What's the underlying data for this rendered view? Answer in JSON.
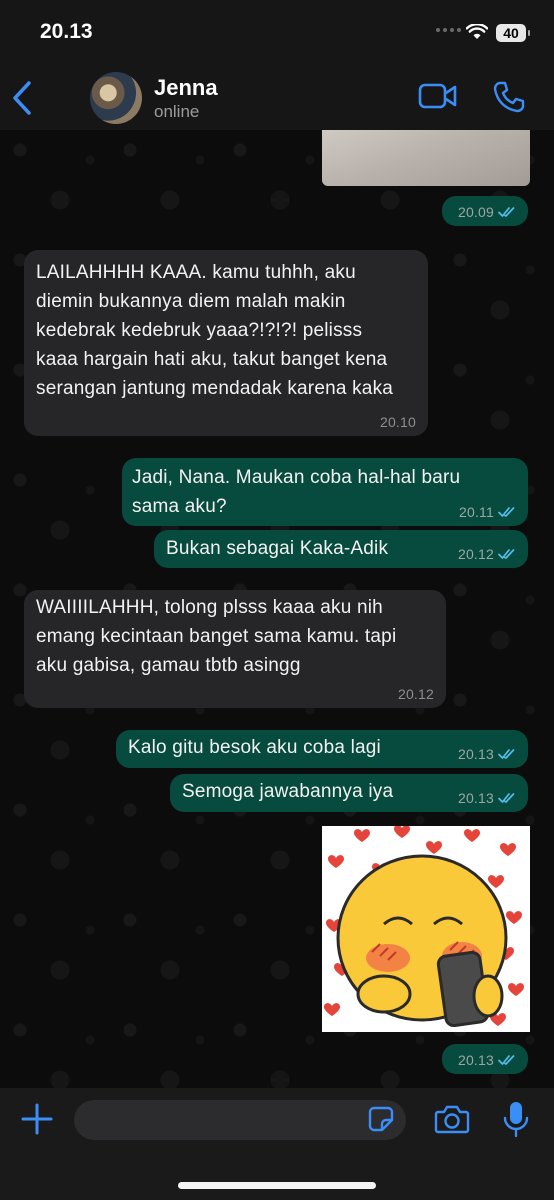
{
  "status_bar": {
    "time": "20.13",
    "battery": "40"
  },
  "contact": {
    "name": "Jenna",
    "status": "online"
  },
  "messages": [
    {
      "time": "20.09"
    },
    {
      "text": "LAILAHHHH KAAA. kamu tuhhh, aku diemin bukannya diem malah makin kedebrak kedebruk yaaa?!?!?! pelisss kaaa hargain hati aku, takut banget kena serangan jantung mendadak karena kaka",
      "time": "20.10"
    },
    {
      "text": "Jadi, Nana. Maukan coba hal-hal baru sama aku?",
      "time": "20.11"
    },
    {
      "text": "Bukan sebagai Kaka-Adik",
      "time": "20.12"
    },
    {
      "text": "WAIIIILAHHH, tolong plsss kaaa aku nih emang kecintaan banget sama kamu. tapi aku gabisa, gamau tbtb asingg",
      "time": "20.12"
    },
    {
      "text": "Kalo gitu besok aku coba lagi",
      "time": "20.13"
    },
    {
      "text": "Semoga jawabannya iya",
      "time": "20.13"
    },
    {
      "time": "20.13"
    }
  ],
  "colors": {
    "accent": "#3a8ef6",
    "outgoing_bubble": "#064b3d",
    "incoming_bubble": "#262628",
    "read_ticks": "#53bdeb"
  },
  "icons": [
    "back-chevron-icon",
    "video-call-icon",
    "phone-icon",
    "plus-icon",
    "sticker-icon",
    "camera-icon",
    "microphone-icon",
    "double-check-icon"
  ]
}
